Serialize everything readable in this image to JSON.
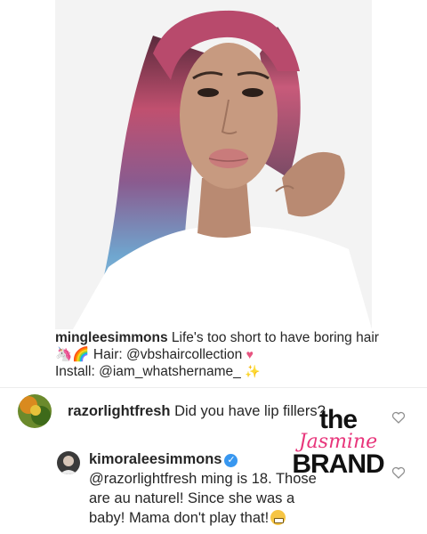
{
  "post": {
    "caption_user": "mingleesimmons",
    "caption_line1": " Life's too short to have boring hair",
    "caption_line2": " Hair: @vbshaircollection ",
    "caption_line3": "Install: @iam_whatshername_ ",
    "emoji": [
      "unicorn-icon",
      "rainbow-icon",
      "pink-heart-icon",
      "sparkles-icon"
    ]
  },
  "comments": [
    {
      "user": "razorlightfresh",
      "text": " Did you have lip fillers?"
    },
    {
      "user": "kimoraleesimmons",
      "text_line1": "@razorlightfresh ming is 18. Those",
      "text_line2": "are au naturel! Since she was a",
      "text_line3": "baby! Mama don't play that!",
      "verified": true
    }
  ],
  "watermark": {
    "the": "the",
    "jasmine": "Jasmine",
    "brand": "BRAND"
  },
  "colors": {
    "verified_blue": "#3897f0",
    "watermark_pink": "#e8357b",
    "hair_pink": "#d9557e",
    "hair_blue": "#7fb3d4"
  }
}
